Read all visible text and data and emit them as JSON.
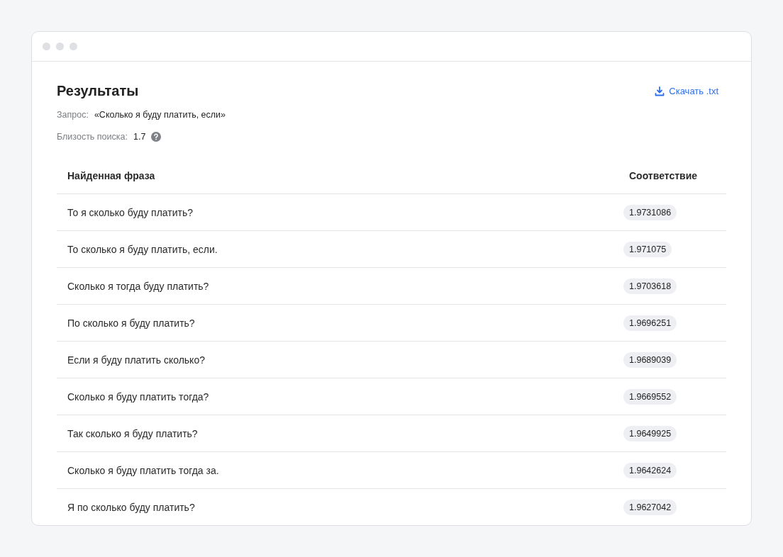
{
  "title": "Результаты",
  "download_link": "Скачать .txt",
  "query": {
    "label": "Запрос:",
    "value": "«Сколько я буду платить, если»"
  },
  "proximity": {
    "label": "Близость поиска:",
    "value": "1.7"
  },
  "table": {
    "columns": [
      "Найденная фраза",
      "Соответствие"
    ],
    "rows": [
      {
        "phrase": "То я сколько буду платить?",
        "score": "1.9731086"
      },
      {
        "phrase": "То сколько я буду платить, если.",
        "score": "1.971075"
      },
      {
        "phrase": "Сколько я тогда буду платить?",
        "score": "1.9703618"
      },
      {
        "phrase": "По сколько я буду платить?",
        "score": "1.9696251"
      },
      {
        "phrase": "Если я буду платить сколько?",
        "score": "1.9689039"
      },
      {
        "phrase": "Сколько я буду платить тогда?",
        "score": "1.9669552"
      },
      {
        "phrase": "Так сколько я буду платить?",
        "score": "1.9649925"
      },
      {
        "phrase": "Сколько я буду платить тогда за.",
        "score": "1.9642624"
      },
      {
        "phrase": "Я по сколько буду платить?",
        "score": "1.9627042"
      }
    ]
  }
}
